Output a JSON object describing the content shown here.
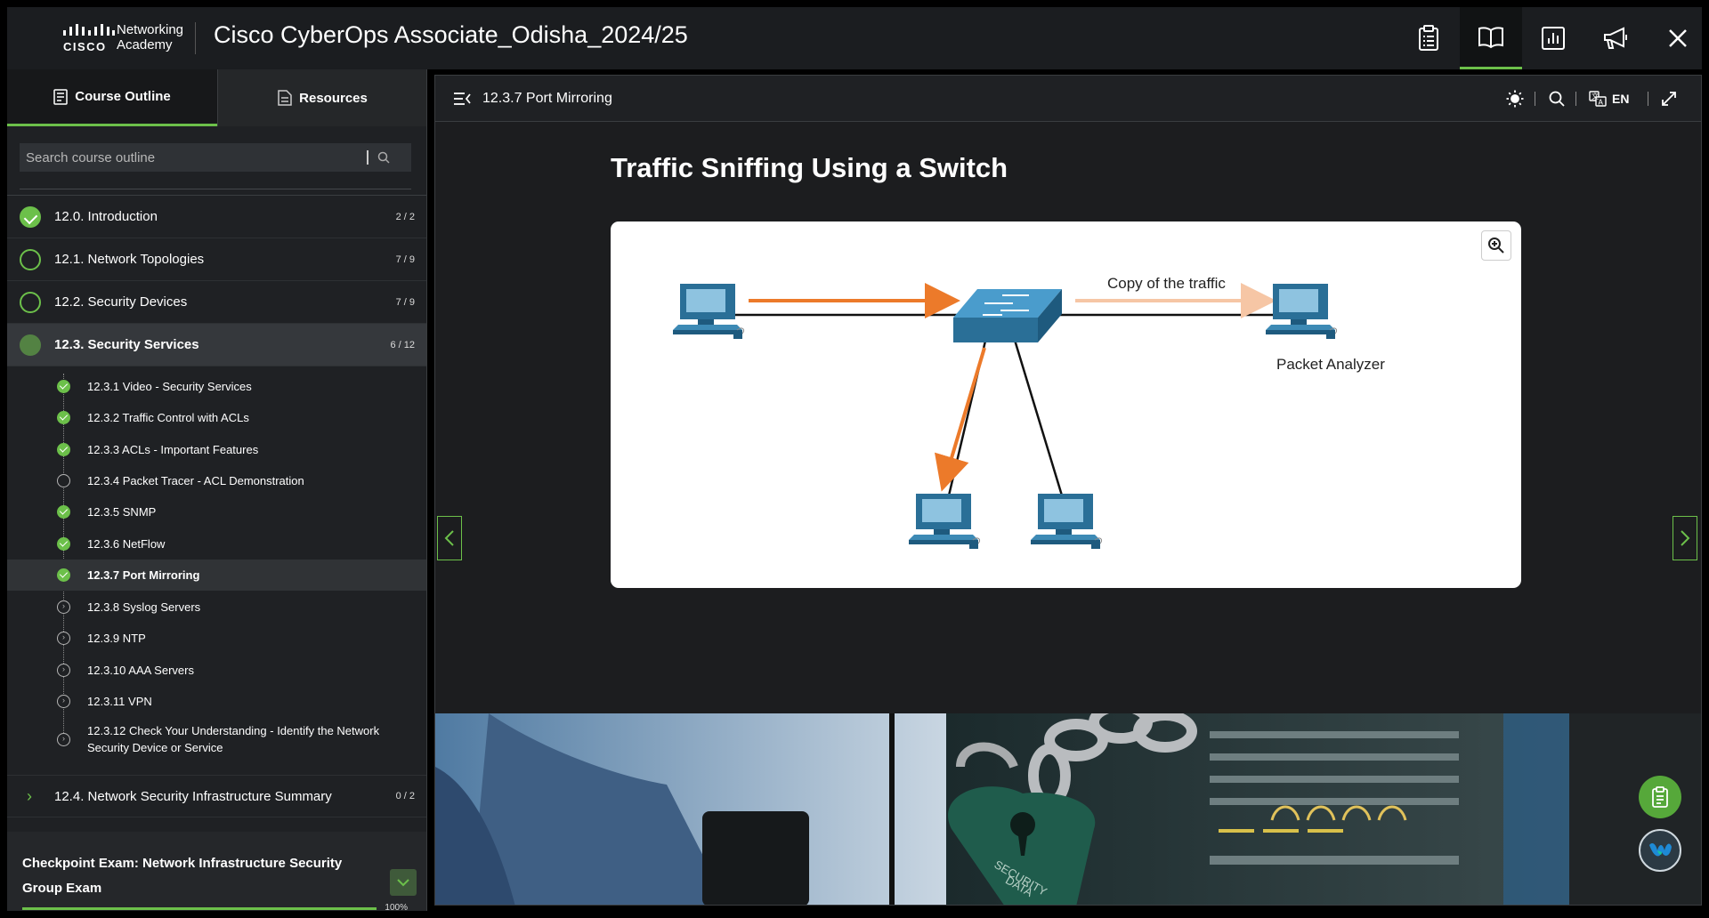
{
  "header": {
    "logo_word": "CISCO",
    "logo_line1": "Networking",
    "logo_line2": "Academy",
    "course_title": "Cisco CyberOps Associate_Odisha_2024/25",
    "icons": [
      "clipboard-icon",
      "book-icon",
      "chart-icon",
      "megaphone-icon",
      "close-icon"
    ],
    "accent_color": "#6cc04a"
  },
  "sidebar": {
    "tabs": [
      {
        "label": "Course Outline",
        "icon": "outline-icon",
        "active": true
      },
      {
        "label": "Resources",
        "icon": "document-icon",
        "active": false
      }
    ],
    "search_placeholder": "Search course outline",
    "modules": [
      {
        "label": "12.0. Introduction",
        "count": "2 / 2",
        "status": "done"
      },
      {
        "label": "12.1. Network Topologies",
        "count": "7 / 9",
        "status": "open"
      },
      {
        "label": "12.2. Security Devices",
        "count": "7 / 9",
        "status": "open"
      },
      {
        "label": "12.3. Security Services",
        "count": "6 / 12",
        "status": "current"
      }
    ],
    "topics": [
      {
        "label": "12.3.1 Video - Security Services",
        "status": "done"
      },
      {
        "label": "12.3.2 Traffic Control with ACLs",
        "status": "done"
      },
      {
        "label": "12.3.3 ACLs - Important Features",
        "status": "done"
      },
      {
        "label": "12.3.4 Packet Tracer - ACL Demonstration",
        "status": "empty"
      },
      {
        "label": "12.3.5 SNMP",
        "status": "done"
      },
      {
        "label": "12.3.6 NetFlow",
        "status": "done"
      },
      {
        "label": "12.3.7 Port Mirroring",
        "status": "done"
      },
      {
        "label": "12.3.8 Syslog Servers",
        "status": "next"
      },
      {
        "label": "12.3.9 NTP",
        "status": "next"
      },
      {
        "label": "12.3.10 AAA Servers",
        "status": "next"
      },
      {
        "label": "12.3.11 VPN",
        "status": "next"
      },
      {
        "label": "12.3.12 Check Your Understanding - Identify the Network Security Device or Service",
        "status": "next"
      }
    ],
    "next_module": {
      "label": "12.4. Network Security Infrastructure Summary",
      "count": "0 / 2"
    },
    "checkpoint": {
      "title": "Checkpoint Exam: Network Infrastructure Security Group Exam",
      "percent_label": "100%",
      "progress": 1.0
    }
  },
  "content": {
    "page_title": "12.3.7 Port Mirroring",
    "language": "EN",
    "slide_heading": "Traffic Sniffing Using a Switch",
    "diagram": {
      "copy_label": "Copy of the traffic",
      "analyzer_label": "Packet Analyzer"
    }
  }
}
